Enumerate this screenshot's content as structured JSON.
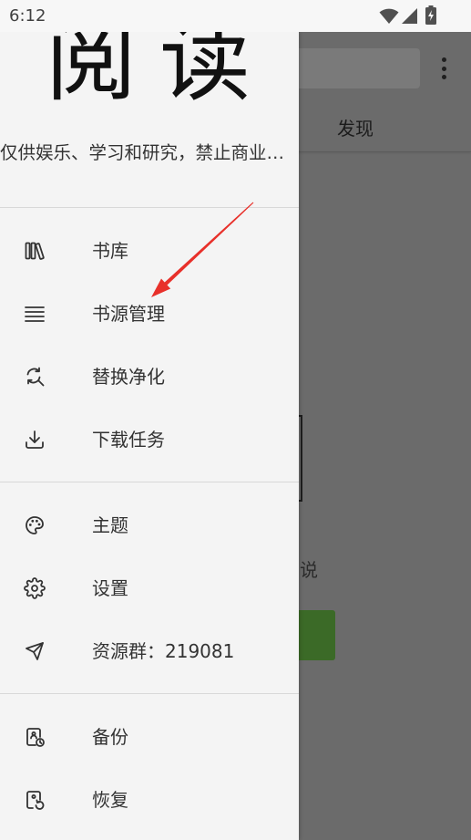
{
  "status_bar": {
    "time": "6:12",
    "icons": [
      "wifi-icon",
      "signal-icon",
      "battery-charging-icon"
    ]
  },
  "drawer": {
    "header": {
      "title": "阅读",
      "subtitle": "仅供娱乐、学习和研究，禁止商业…"
    },
    "main_items": [
      {
        "label": "书库",
        "icon": "bookshelf-icon"
      },
      {
        "label": "书源管理",
        "icon": "list-icon"
      },
      {
        "label": "替换净化",
        "icon": "find-replace-icon"
      },
      {
        "label": "下载任务",
        "icon": "download-icon"
      }
    ],
    "settings_items": [
      {
        "label": "主题",
        "icon": "palette-icon"
      },
      {
        "label": "设置",
        "icon": "gear-icon"
      },
      {
        "label": "资源群：219081",
        "icon": "send-icon"
      }
    ],
    "backup_items": [
      {
        "label": "备份",
        "icon": "backup-icon"
      },
      {
        "label": "恢复",
        "icon": "restore-icon"
      }
    ]
  },
  "background_app": {
    "tab_label": "发现",
    "partial_text": "说",
    "menu_icon": "more-vert-icon"
  },
  "colors": {
    "drawer_background": "#f4f4f4",
    "scrim": "#6b6b6b",
    "status_bar": "#f7f7f7",
    "annotation": "#e8302a",
    "button_green": "#3b6a27"
  }
}
